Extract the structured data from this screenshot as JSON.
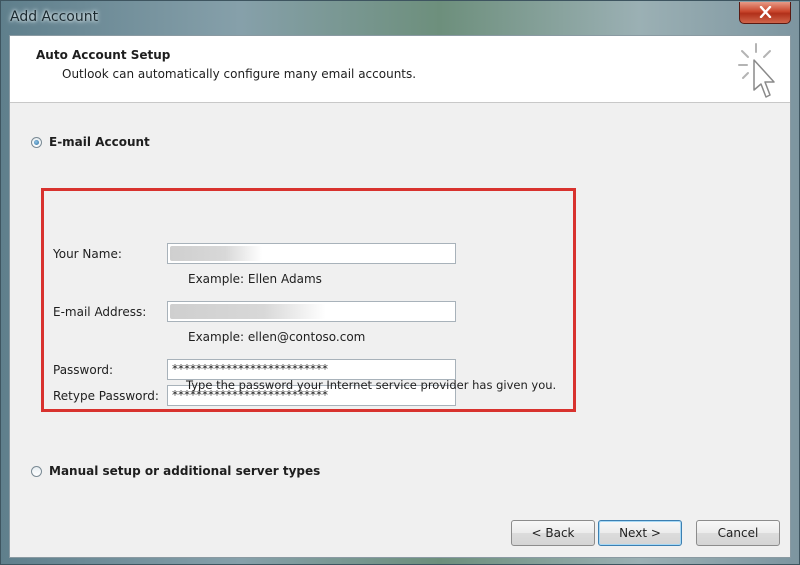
{
  "window": {
    "title": "Add Account"
  },
  "header": {
    "title": "Auto Account Setup",
    "subtitle": "Outlook can automatically configure many email accounts."
  },
  "options": {
    "email_account": {
      "label": "E-mail Account",
      "selected": true
    },
    "manual_setup": {
      "label": "Manual setup or additional server types",
      "selected": false
    }
  },
  "form": {
    "name": {
      "label": "Your Name:",
      "value": "",
      "hint": "Example: Ellen Adams"
    },
    "email": {
      "label": "E-mail Address:",
      "value": "",
      "hint": "Example: ellen@contoso.com"
    },
    "password": {
      "label": "Password:",
      "value": "**************************"
    },
    "retype_password": {
      "label": "Retype Password:",
      "value": "**************************"
    },
    "password_hint": "Type the password your Internet service provider has given you."
  },
  "buttons": {
    "back": "< Back",
    "next": "Next >",
    "cancel": "Cancel"
  },
  "colors": {
    "highlight_border": "#d8322e",
    "default_button_border": "#3c7fb1"
  }
}
